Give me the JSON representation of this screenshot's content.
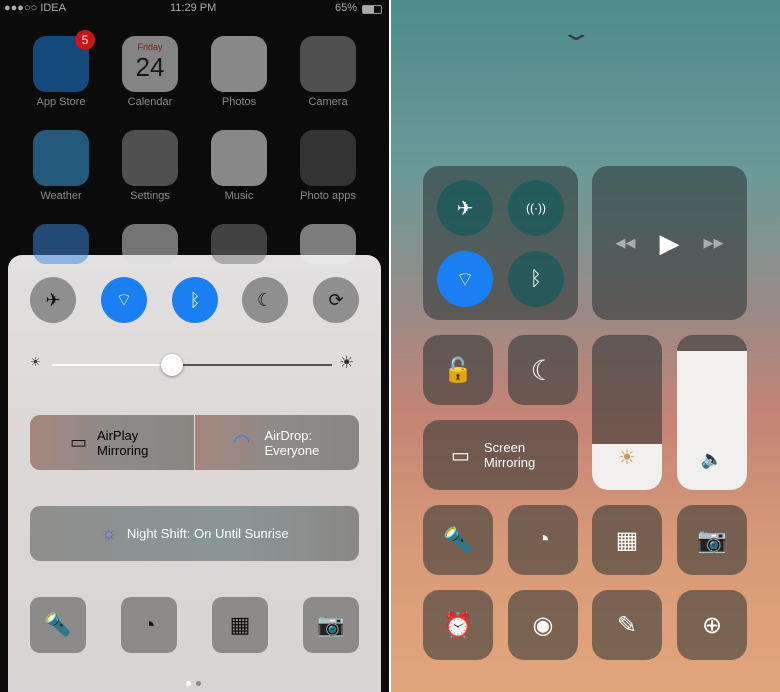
{
  "ios10": {
    "status": {
      "carrier": "●●●○○ IDEA",
      "time": "11:29 PM",
      "battery": "65%"
    },
    "apps": [
      {
        "label": "App Store",
        "badge": "5",
        "color": "#1e7fd8"
      },
      {
        "label": "Calendar",
        "day": "Friday",
        "date": "24",
        "color": "#e8e8e8"
      },
      {
        "label": "Photos",
        "color": "#f0f0f0"
      },
      {
        "label": "Camera",
        "color": "#888"
      },
      {
        "label": "Weather",
        "color": "#3a9ad8"
      },
      {
        "label": "Settings",
        "color": "#8a8a8a"
      },
      {
        "label": "Music",
        "color": "#f0f0f0"
      },
      {
        "label": "Photo apps",
        "color": "#555"
      }
    ],
    "partial_row_colors": [
      "#3a8ae0",
      "#ddd",
      "#777",
      "#eee"
    ],
    "toggles": [
      {
        "name": "airplane",
        "glyph": "✈",
        "on": false
      },
      {
        "name": "wifi",
        "glyph": "⌔",
        "on": true
      },
      {
        "name": "bluetooth",
        "glyph": "ᛒ",
        "on": true
      },
      {
        "name": "do-not-disturb",
        "glyph": "☾",
        "on": false
      },
      {
        "name": "rotation-lock",
        "glyph": "⟳",
        "on": false
      }
    ],
    "brightness_percent": 43,
    "airplay": {
      "line1": "AirPlay",
      "line2": "Mirroring"
    },
    "airdrop": {
      "line1": "AirDrop:",
      "line2": "Everyone"
    },
    "night_shift": "Night Shift: On Until Sunrise",
    "shortcuts": [
      {
        "name": "flashlight",
        "glyph": "🔦"
      },
      {
        "name": "timer",
        "glyph": "◔"
      },
      {
        "name": "calculator",
        "glyph": "▦"
      },
      {
        "name": "camera",
        "glyph": "📷"
      }
    ],
    "page": 1,
    "pages": 2
  },
  "ios11": {
    "connectivity": [
      {
        "name": "airplane",
        "glyph": "✈",
        "on": false
      },
      {
        "name": "cellular",
        "glyph": "((·))",
        "on": false
      },
      {
        "name": "wifi",
        "glyph": "⌔",
        "on": true
      },
      {
        "name": "bluetooth",
        "glyph": "ᛒ",
        "on": false
      }
    ],
    "media": {
      "prev": "◀◀",
      "play": "▶",
      "next": "▶▶"
    },
    "screen_mirroring": {
      "line1": "Screen",
      "line2": "Mirroring"
    },
    "brightness_percent": 30,
    "volume_percent": 90,
    "tiles": [
      {
        "name": "flashlight",
        "glyph": "🔦"
      },
      {
        "name": "timer",
        "glyph": "◔"
      },
      {
        "name": "calculator",
        "glyph": "▦"
      },
      {
        "name": "camera",
        "glyph": "📷"
      },
      {
        "name": "alarm",
        "glyph": "⏰"
      },
      {
        "name": "screen-record",
        "glyph": "◉"
      },
      {
        "name": "notes",
        "glyph": "✎"
      },
      {
        "name": "magnifier",
        "glyph": "⊕"
      }
    ]
  }
}
